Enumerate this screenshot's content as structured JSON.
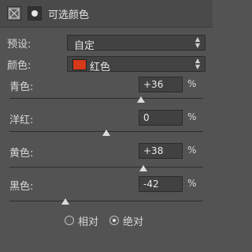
{
  "header": {
    "title": "可选颜色"
  },
  "preset": {
    "label": "预设:",
    "value": "自定"
  },
  "color": {
    "label": "颜色:",
    "value": "红色",
    "swatch": "#d63a1a"
  },
  "sliders": [
    {
      "label": "青色:",
      "value": "+36",
      "level": 36
    },
    {
      "label": "洋红:",
      "value": "0",
      "level": 0
    },
    {
      "label": "黄色:",
      "value": "+38",
      "level": 38
    },
    {
      "label": "黑色:",
      "value": "-42",
      "level": -42
    }
  ],
  "percent_sign": "%",
  "method": {
    "options": [
      "相对",
      "绝对"
    ],
    "selected": "绝对"
  }
}
